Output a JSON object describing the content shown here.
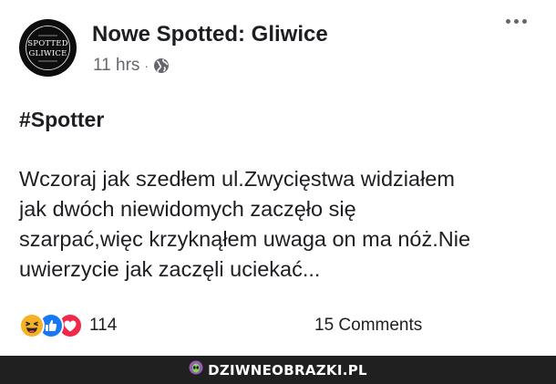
{
  "post": {
    "page_avatar": {
      "line1": "SPOTTED",
      "line2": "GLIWICE"
    },
    "page_name": "Nowe Spotted: Gliwice",
    "time": "11 hrs",
    "separator": "·",
    "privacy_icon": "globe-icon",
    "more_icon": "more-options-icon",
    "hashtag": "#Spotter",
    "body_lines": [
      "Wczoraj jak szedłem ul.Zwycięstwa widziałem",
      "jak dwóch niewidomych zaczęło się",
      "szarpać,więc krzyknąłem uwaga on ma nóż.Nie",
      "uwierzycie jak zaczęli uciekać..."
    ]
  },
  "footer": {
    "reaction_icons": [
      "haha-reaction-icon",
      "like-reaction-icon",
      "love-reaction-icon"
    ],
    "reaction_count": "114",
    "comments": "15 Comments"
  },
  "watermark": {
    "text": "DZIWNEOBRAZKI.PL"
  },
  "colors": {
    "text": "#1c1e21",
    "secondary": "#65676b",
    "like": "#1877f2",
    "love": "#f02849",
    "haha": "#f7b125",
    "watermark_bar": "#202020"
  }
}
